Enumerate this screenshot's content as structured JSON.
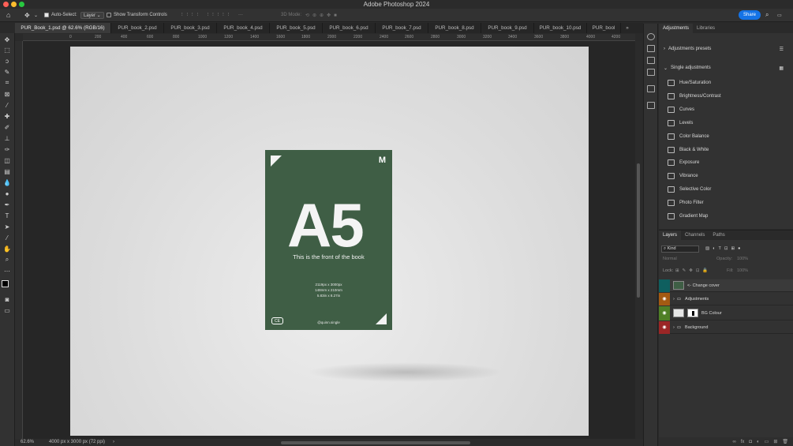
{
  "window": {
    "title": "Adobe Photoshop 2024",
    "traffic_lights": [
      "#ff5f57",
      "#febc2e",
      "#28c840"
    ]
  },
  "options_bar": {
    "auto_select_label": "Auto-Select:",
    "auto_select_value": "Layer",
    "show_transform_label": "Show Transform Controls",
    "mode_3d_label": "3D Mode:",
    "share_label": "Share"
  },
  "tabs": [
    {
      "label": "PUR_Book_1.psd @ 62.6% (RGB/16)",
      "active": true
    },
    {
      "label": "PUR_book_2.psd"
    },
    {
      "label": "PUR_book_3.psd"
    },
    {
      "label": "PUR_book_4.psd"
    },
    {
      "label": "PUR_book_5.psd"
    },
    {
      "label": "PUR_book_6.psd"
    },
    {
      "label": "PUR_book_7.psd"
    },
    {
      "label": "PUR_book_8.psd"
    },
    {
      "label": "PUR_book_9.psd"
    },
    {
      "label": "PUR_book_10.psd"
    },
    {
      "label": "PUR_bool"
    }
  ],
  "tabs_overflow": "»",
  "ruler_marks": [
    "0",
    "200",
    "400",
    "600",
    "800",
    "1000",
    "1200",
    "1400",
    "1600",
    "1800",
    "2000",
    "2200",
    "2400",
    "2600",
    "2800",
    "3000",
    "3200",
    "3400",
    "3600",
    "3800",
    "4000",
    "4200"
  ],
  "book": {
    "headline": "A5",
    "subtitle": "This is the front of the book",
    "specs": [
      "2119px x 3000px",
      "148mm x 210mm",
      "5.83in x 8.27in"
    ],
    "handle": "@quinn.single",
    "badge": "CE",
    "cover_color": "#3f5e45"
  },
  "status": {
    "zoom": "62.6%",
    "doc_info": "4000 px x 3000 px (72 ppi)",
    "arrow": "›"
  },
  "adjustments_panel": {
    "tabs": [
      "Adjustments",
      "Libraries"
    ],
    "presets_label": "Adjustments presets",
    "single_label": "Single adjustments",
    "items": [
      "Hue/Saturation",
      "Brightness/Contrast",
      "Curves",
      "Levels",
      "Color Balance",
      "Black & White",
      "Exposure",
      "Vibrance",
      "Selective Color",
      "Photo Filter",
      "Gradient Map"
    ]
  },
  "layers_panel": {
    "tabs": [
      "Layers",
      "Channels",
      "Paths"
    ],
    "filter_label": "Kind",
    "blend_mode": "Normal",
    "opacity_label": "Opacity:",
    "opacity_value": "100%",
    "lock_label": "Lock:",
    "fill_label": "Fill:",
    "fill_value": "100%",
    "layers": [
      {
        "name": "<- Change cover",
        "color": "#0f5f5f"
      },
      {
        "name": "Adjustments",
        "color": "#a35a12"
      },
      {
        "name": "BG Colour",
        "color": "#4f7f26"
      },
      {
        "name": "Background",
        "color": "#9b2626"
      }
    ]
  }
}
